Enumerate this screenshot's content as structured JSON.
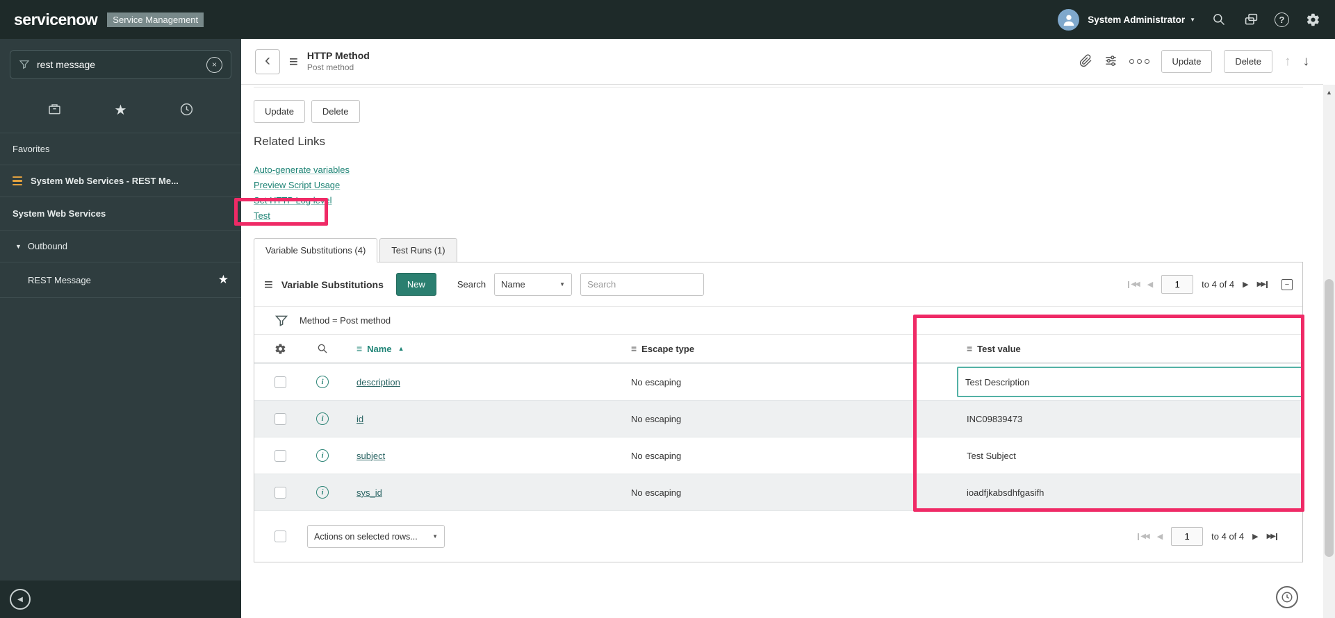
{
  "colors": {
    "accent_teal": "#2b7f70",
    "link_teal": "#1f8476",
    "highlight_pink": "#ef2a66"
  },
  "icons": {
    "caret_down": "▼",
    "triangle_down": "▼",
    "sort_asc": "▲",
    "arrow_prev": "◀",
    "arrow_next": "▶",
    "arrow_first": "◀◀",
    "arrow_last": "▶▶",
    "star": "★",
    "hamburger": "≡",
    "info": "i",
    "clear": "×",
    "back": "‹",
    "arrow_up": "↑",
    "arrow_down": "↓",
    "collapse_left": "◀",
    "scroll_up": "▲",
    "minus": "−",
    "question": "?"
  },
  "header": {
    "logo": "servicenow",
    "app_label": "Service Management",
    "user_name": "System Administrator"
  },
  "sidebar": {
    "search_value": "rest message",
    "favorites_title": "Favorites",
    "favorite_item": "System Web Services - REST Me...",
    "section_title": "System Web Services",
    "outbound_label": "Outbound",
    "rest_message_label": "REST Message"
  },
  "form_header": {
    "title": "HTTP Method",
    "subtitle": "Post method",
    "update_label": "Update",
    "delete_label": "Delete"
  },
  "content": {
    "update_label": "Update",
    "delete_label": "Delete",
    "related_links_title": "Related Links",
    "links": [
      "Auto-generate variables",
      "Preview Script Usage",
      "Set HTTP Log level",
      "Test"
    ]
  },
  "tabs": [
    {
      "label": "Variable Substitutions (4)"
    },
    {
      "label": "Test Runs (1)"
    }
  ],
  "list": {
    "title": "Variable Substitutions",
    "new_label": "New",
    "search_label": "Search",
    "search_field": "Name",
    "search_placeholder": "Search",
    "filter": "Method = Post method",
    "pagination": {
      "page": "1",
      "range": "to 4 of 4"
    },
    "columns": [
      "Name",
      "Escape type",
      "Test value"
    ],
    "rows": [
      {
        "name": "description",
        "escape_type": "No escaping",
        "test_value": "Test Description"
      },
      {
        "name": "id",
        "escape_type": "No escaping",
        "test_value": "INC09839473"
      },
      {
        "name": "subject",
        "escape_type": "No escaping",
        "test_value": "Test Subject"
      },
      {
        "name": "sys_id",
        "escape_type": "No escaping",
        "test_value": "ioadfjkabsdhfgasifh"
      }
    ],
    "actions_label": "Actions on selected rows..."
  }
}
